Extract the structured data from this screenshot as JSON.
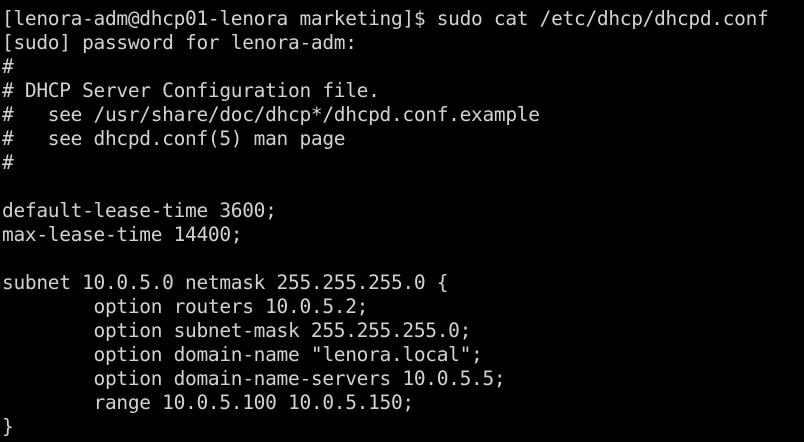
{
  "terminal": {
    "lines": [
      "[lenora-adm@dhcp01-lenora marketing]$ sudo cat /etc/dhcp/dhcpd.conf",
      "[sudo] password for lenora-adm:",
      "#",
      "# DHCP Server Configuration file.",
      "#   see /usr/share/doc/dhcp*/dhcpd.conf.example",
      "#   see dhcpd.conf(5) man page",
      "#",
      "",
      "default-lease-time 3600;",
      "max-lease-time 14400;",
      "",
      "subnet 10.0.5.0 netmask 255.255.255.0 {",
      "        option routers 10.0.5.2;",
      "        option subnet-mask 255.255.255.0;",
      "        option domain-name \"lenora.local\";",
      "        option domain-name-servers 10.0.5.5;",
      "        range 10.0.5.100 10.0.5.150;",
      "}"
    ]
  },
  "colors": {
    "background": "#000000",
    "foreground": "#d2d2d2"
  }
}
